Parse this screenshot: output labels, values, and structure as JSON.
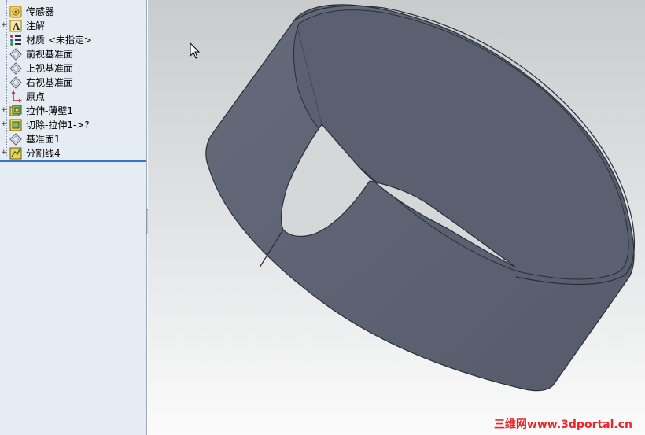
{
  "feature_tree": {
    "items": [
      {
        "label": "传感器",
        "icon": "sensor-icon",
        "expandable": false
      },
      {
        "label": "注解",
        "icon": "annotation-icon",
        "expandable": true
      },
      {
        "label": "材质 <未指定>",
        "icon": "material-icon",
        "expandable": false
      },
      {
        "label": "前视基准面",
        "icon": "plane-icon",
        "expandable": false
      },
      {
        "label": "上视基准面",
        "icon": "plane-icon",
        "expandable": false
      },
      {
        "label": "右视基准面",
        "icon": "plane-icon",
        "expandable": false
      },
      {
        "label": "原点",
        "icon": "origin-icon",
        "expandable": false
      },
      {
        "label": "拉伸-薄壁1",
        "icon": "extrude-thin-icon",
        "expandable": true
      },
      {
        "label": "切除-拉伸1->?",
        "icon": "cut-extrude-icon",
        "expandable": true
      },
      {
        "label": "基准面1",
        "icon": "plane-icon",
        "expandable": false
      },
      {
        "label": "分割线4",
        "icon": "split-line-icon",
        "expandable": true
      }
    ]
  },
  "viewport": {
    "model": "thin-wall-cylinder-with-cut",
    "watermark": "三维网www.3dportal.cn"
  },
  "colors": {
    "tree_bg": "#e6ecf4",
    "model_face": "#5c6272",
    "watermark": "#e8262a"
  }
}
